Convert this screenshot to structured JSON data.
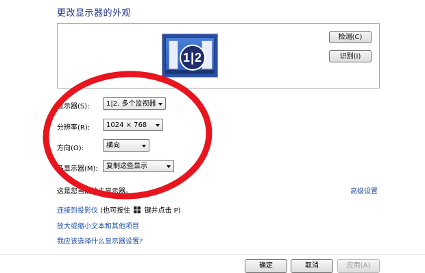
{
  "title": "更改显示器的外观",
  "preview": {
    "monitor_label": "1|2",
    "detect_label": "检测(C)",
    "identify_label": "识别(I)"
  },
  "settings": {
    "display_label": "显示器(S):",
    "display_value": "1|2. 多个监视器",
    "resolution_label": "分辨率(R):",
    "resolution_value": "1024 × 768",
    "orientation_label": "方向(O):",
    "orientation_value": "横向",
    "multi_label": "多显示器(M):",
    "multi_value": "复制这些显示"
  },
  "status_text": "这是您当前的主显示器。",
  "advanced_link": "高级设置",
  "links": {
    "projector_prefix": "连接到投影仪",
    "projector_hint_a": "(也可按住",
    "projector_hint_b": "键并点击 P)",
    "text_size": "放大或缩小文本和其他项目",
    "which_settings": "我应该选择什么显示器设置?"
  },
  "footer": {
    "ok_label": "确定",
    "cancel_label": "取消",
    "apply_label": "应用(A)"
  },
  "colors": {
    "accent": "#1e3287",
    "link": "#1f4ea8",
    "annotation": "#e8141e"
  },
  "icons": [
    "windows-logo-icon",
    "dropdown-arrow-icon"
  ]
}
